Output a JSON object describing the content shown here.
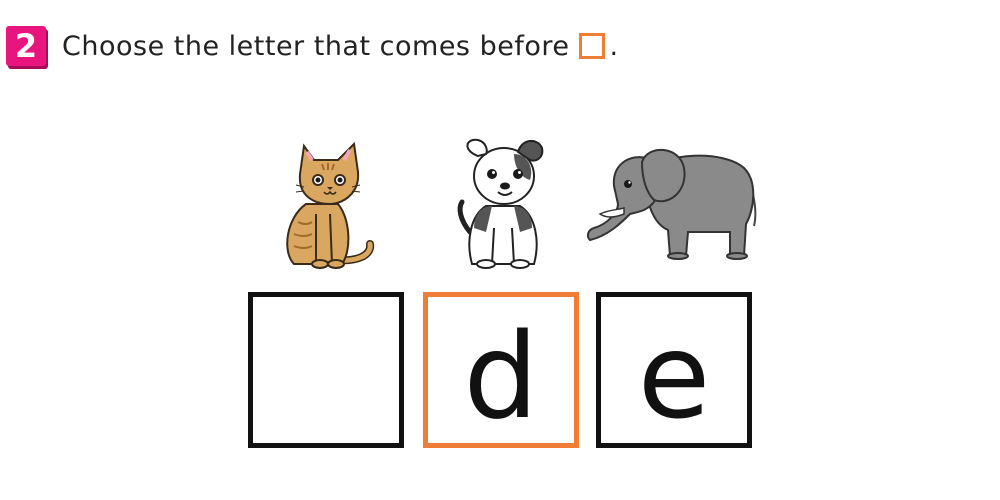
{
  "question": {
    "number": "2",
    "prompt_text": "Choose the letter that comes before",
    "prompt_end": "."
  },
  "animals": [
    {
      "icon": "cat-icon"
    },
    {
      "icon": "dog-icon"
    },
    {
      "icon": "elephant-icon"
    }
  ],
  "letter_boxes": [
    {
      "letter": "",
      "highlighted": false
    },
    {
      "letter": "d",
      "highlighted": true
    },
    {
      "letter": "e",
      "highlighted": false
    }
  ],
  "colors": {
    "badge": "#e8157f",
    "highlight": "#ef7d35",
    "box_border": "#111111",
    "cat": "#d9a75f",
    "elephant": "#8a8a8a"
  }
}
